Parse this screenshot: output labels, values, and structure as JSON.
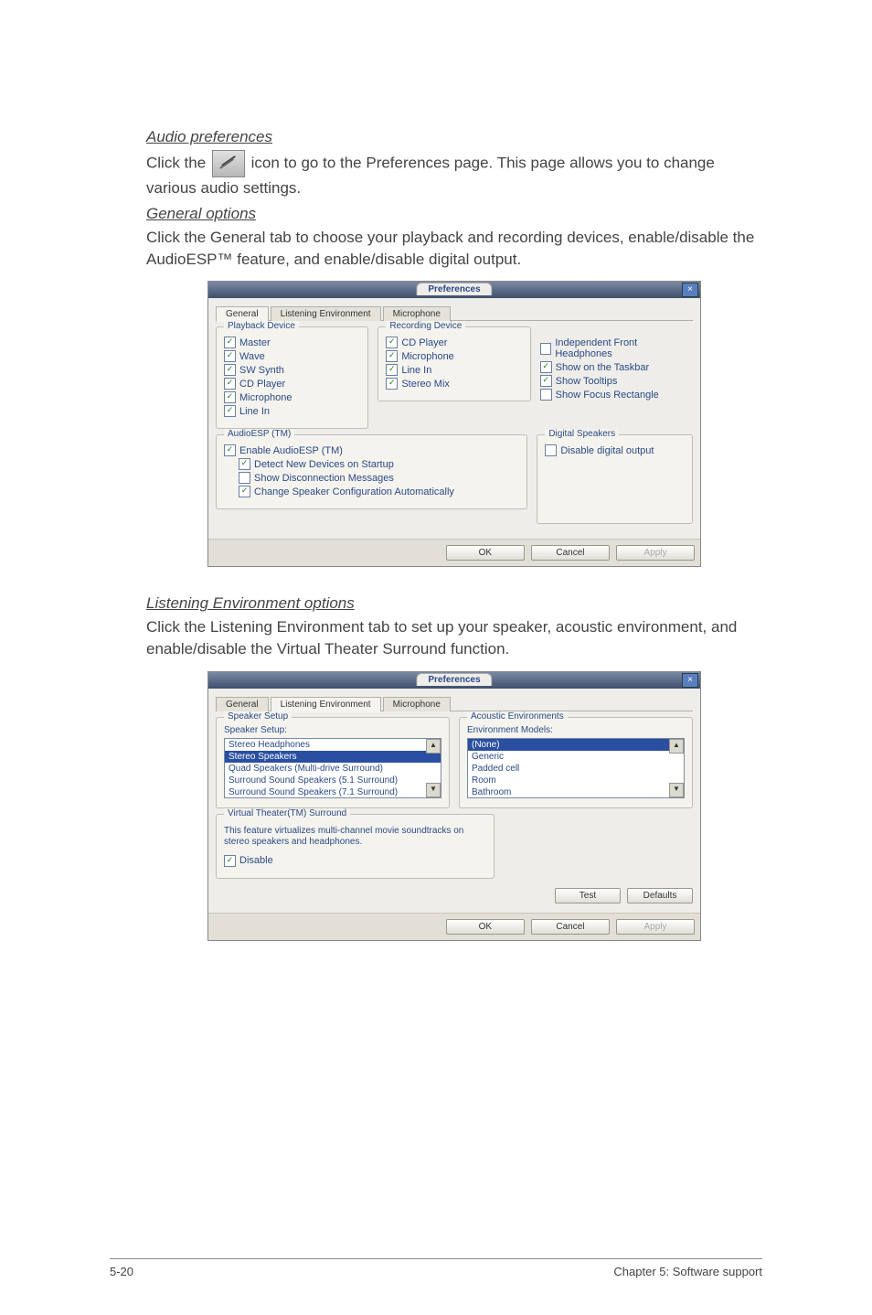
{
  "section1": {
    "heading": "Audio preferences",
    "p1a": "Click the ",
    "p1b": " icon to go to the Preferences page. This page allows you to change various audio settings."
  },
  "section2": {
    "heading": "General options",
    "p1": "Click the General tab to choose your playback and recording devices, enable/disable the AudioESP™ feature, and enable/disable digital output."
  },
  "dlg1": {
    "title": "Preferences",
    "tabs": {
      "general": "General",
      "listening": "Listening Environment",
      "mic": "Microphone"
    },
    "playback": {
      "label": "Playback Device",
      "items": [
        "Master",
        "Wave",
        "SW Synth",
        "CD Player",
        "Microphone",
        "Line In"
      ]
    },
    "recording": {
      "label": "Recording Device",
      "items": [
        "CD Player",
        "Microphone",
        "Line In",
        "Stereo Mix"
      ]
    },
    "rightchecks": {
      "independent": "Independent Front Headphones",
      "taskbar": "Show on the Taskbar",
      "tooltips": "Show Tooltips",
      "focusrect": "Show Focus Rectangle"
    },
    "audioesp": {
      "label": "AudioESP (TM)",
      "enable": "Enable AudioESP (TM)",
      "detect": "Detect New Devices on Startup",
      "showdisc": "Show Disconnection Messages",
      "changespk": "Change Speaker Configuration Automatically"
    },
    "digital": {
      "label": "Digital Speakers",
      "disable": "Disable digital output"
    },
    "buttons": {
      "ok": "OK",
      "cancel": "Cancel",
      "apply": "Apply"
    }
  },
  "section3": {
    "heading": "Listening Environment options",
    "p1": "Click the Listening Environment tab to set up your speaker, acoustic environment, and enable/disable the Virtual Theater Surround function."
  },
  "dlg2": {
    "title": "Preferences",
    "tabs": {
      "general": "General",
      "listening": "Listening Environment",
      "mic": "Microphone"
    },
    "spksetup": {
      "label": "Speaker Setup",
      "sublabel": "Speaker Setup:",
      "items": [
        "Stereo Headphones",
        "Stereo Speakers",
        "Quad Speakers (Multi-drive Surround)",
        "Surround Sound Speakers (5.1 Surround)",
        "Surround Sound Speakers (7.1 Surround)"
      ]
    },
    "env": {
      "label": "Acoustic Environments",
      "sublabel": "Environment Models:",
      "items": [
        "(None)",
        "Generic",
        "Padded cell",
        "Room",
        "Bathroom"
      ]
    },
    "vt": {
      "label": "Virtual Theater(TM) Surround",
      "desc": "This feature virtualizes multi-channel movie soundtracks on stereo speakers and headphones.",
      "disable": "Disable"
    },
    "buttons": {
      "test": "Test",
      "defaults": "Defaults",
      "ok": "OK",
      "cancel": "Cancel",
      "apply": "Apply"
    }
  },
  "footer": {
    "left": "5-20",
    "right": "Chapter 5: Software support"
  }
}
